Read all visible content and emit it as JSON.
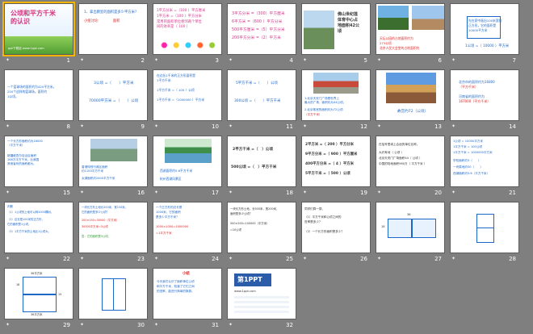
{
  "slides": [
    {
      "n": "1",
      "title": "公顷和平方千米\n的认识",
      "sub": "ppt下载站 www.1ppt.com"
    },
    {
      "n": "2",
      "lines": [
        "1、拿出教室的面积是多少平方米?",
        "　",
        "小组讨论:　　　　面积"
      ]
    },
    {
      "n": "3",
      "lines": [
        "1平方分米 =（100 ）平方厘米",
        "1平方米 =（100 ）平方分米",
        "常用的面积单位相邻两个单位",
        "间的进率是（ 100 ）"
      ]
    },
    {
      "n": "4",
      "lines": [
        "3平方分米 =（300）平方厘米",
        "6平方米 =（600 ）平方分米",
        "500平方厘米 =（5）平方分米",
        "200平方分米 =（2）平方米"
      ]
    },
    {
      "n": "5",
      "lines": [
        "佛山世纪莲",
        "体育中心占",
        "地面积42公",
        "顷"
      ]
    },
    {
      "n": "6",
      "lines": [
        "天坛公园的占地面积约为",
        "273公顷",
        "",
        "北京人民大会堂的占地面积约",
        "为15公顷"
      ]
    },
    {
      "n": "7",
      "lines": [
        "先在家中画出100米宽的",
        "正方形，它的面积是",
        "10000平方米",
        "",
        "1公顷 =（ 10000 ）平方米"
      ]
    },
    {
      "n": "8",
      "lines": [
        "一个篮球场的面积约为420平方米。",
        "250个这样的篮球场。面积约",
        "1公顷。"
      ]
    },
    {
      "n": "9",
      "lines": [
        "3公顷 =（　　）平方米",
        "",
        "70000平方米 =（　　）公顷"
      ]
    },
    {
      "n": "10",
      "lines": [
        "在边长1千米的正方形面积是",
        "1平方千米",
        "",
        "1平方千米 =（ 100 ）公顷",
        "",
        "1平方千米 =（1000000 ）平方米"
      ]
    },
    {
      "n": "11",
      "lines": [
        "5平方千米 =（　　）公顷",
        "",
        "300公顷 =（　　）平方千米"
      ]
    },
    {
      "n": "12",
      "lines": [
        "1.北京天安门广场是世界上",
        "最大的广场，面积约为44公顷。",
        "",
        "2.北京故宫的面积约为72公顷",
        "（平方千米）"
      ]
    },
    {
      "n": "13",
      "lines": [
        "故宫约72（公顷）"
      ]
    },
    {
      "n": "14",
      "lines": [
        "北京市的面积约为16800",
        "（平方千米）",
        "",
        "河南省的面积约为",
        "167000（平方千米）"
      ]
    },
    {
      "n": "15",
      "lines": [
        "一个长方形面积约为16000",
        "（平方千米）",
        "",
        "新疆维吾尔自治区面积",
        "166万平方千米，比我国",
        "其他省份的面积都大。"
      ]
    },
    {
      "n": "16",
      "lines": [
        "香港特别行政区面积",
        "约1100平方千米",
        "",
        "太湖面积约2400平方千米"
      ]
    },
    {
      "n": "17",
      "lines": [
        "西湖面积约5.6平方千米",
        "",
        "杭州西湖风景区"
      ]
    },
    {
      "n": "18",
      "lines": [
        "2平方千米 =（　）公顷",
        "",
        "500公顷 =（　）平方千米"
      ]
    },
    {
      "n": "19",
      "lines": [
        "2平方米 =（ 200 ）平方分米",
        "9平方分米 =（ 900 ）平方厘米",
        "400平方分米 =（ 4 ）平方米",
        "5平方千米 =（ 500 ）公顷"
      ]
    },
    {
      "n": "20",
      "lines": [
        "在括号里填上合适的单位名称。",
        "",
        "大约有地（ 公顷 ）",
        "北京天安门广场面积44（ 公顷 ）",
        "中国的陆地面积960万（ 平方千米 ）"
      ]
    },
    {
      "n": "21",
      "lines": [
        "1公顷 = 10000平方米",
        "1平方千米 = 100公顷",
        "1平方千米 = 1000000平方米",
        "学校面积约3（　　）",
        "一块菜地约50（　　）",
        "西湖面积约5.6（平方千米）"
      ]
    },
    {
      "n": "22",
      "lines": [
        "判断",
        "（1）1公顷的土地可以种1000棵树。",
        "（2）边长是100米的正方形，",
        "它的面积是1公顷。",
        "（3）1平方千米的土地比1公顷大。"
      ]
    },
    {
      "n": "23",
      "lines": [
        "一块长方形土地长200米，宽150米。",
        "它的面积是多少公顷？",
        "200×150=30000（平方米）",
        "30000平方米=3公顷",
        "答：它的面积是3公顷。"
      ]
    },
    {
      "n": "24",
      "lines": [
        "一个正方形的边长是",
        "1000米，它的面积",
        "是多少平方千米？",
        "1000×1000=1000000",
        "=1平方千米"
      ]
    },
    {
      "n": "25",
      "lines": [
        "一块长方形土地，长500米，宽200米，",
        "面积是多少公顷？",
        "500×200=100000（平方米）",
        "=10公顷"
      ]
    },
    {
      "n": "26",
      "lines": [
        "同学们算一算，",
        "（1）平方千米和公顷之间的",
        "进率是多少？",
        "（2）一个长方形面积是多少？"
      ]
    },
    {
      "n": "27",
      "lines": [
        "18",
        "",
        "36"
      ]
    },
    {
      "n": "28",
      "lines": [
        ""
      ]
    },
    {
      "n": "29",
      "lines": [
        "36平方米",
        "18",
        "15",
        "36平方米"
      ]
    },
    {
      "n": "30",
      "lines": [
        ""
      ]
    },
    {
      "n": "31",
      "lines": [
        "小结",
        "今天我们认识了面积单位公顷",
        "和平方千米，知道了它们之间",
        "的进率，能进行简单的换算。"
      ]
    },
    {
      "n": "32",
      "logo": "第1PPT",
      "lines": [
        "www.1ppt.com"
      ]
    }
  ]
}
